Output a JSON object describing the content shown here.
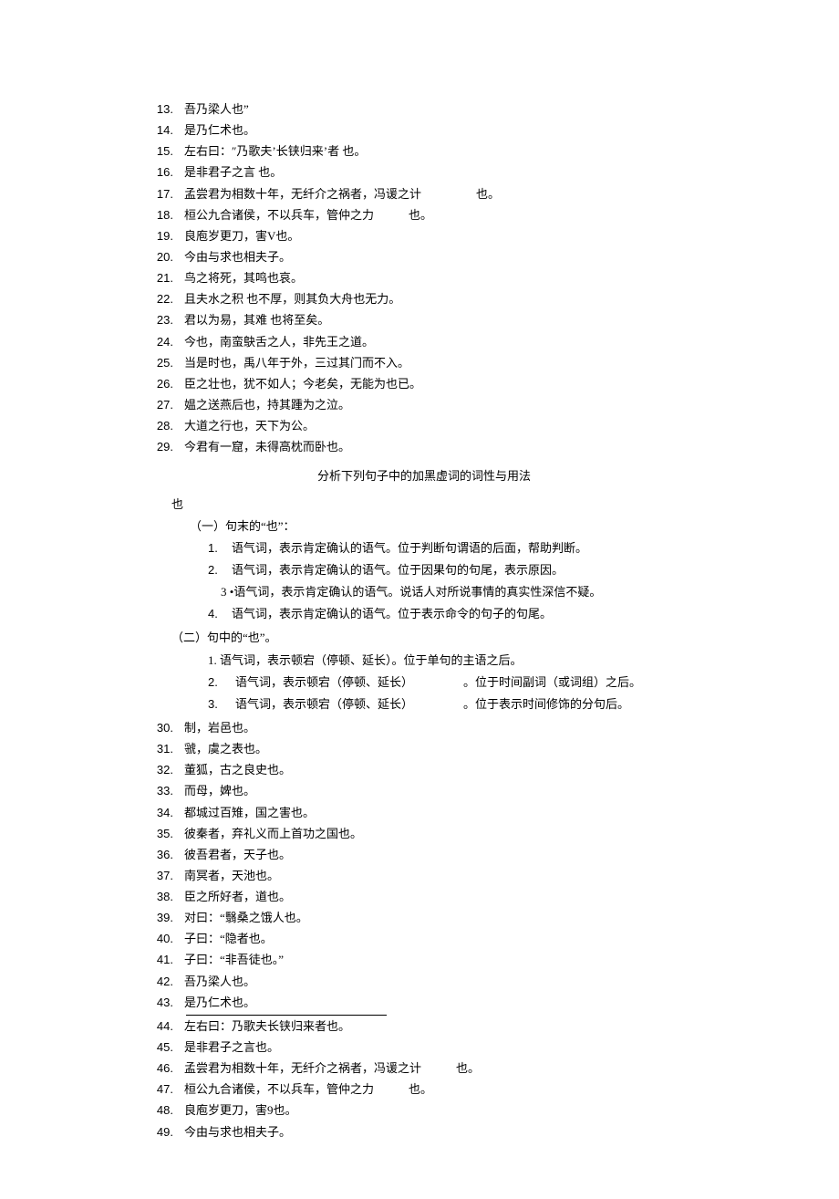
{
  "list1": [
    {
      "n": "13.",
      "t": "吾乃梁人也”"
    },
    {
      "n": "14.",
      "t": "是乃仁术也。"
    },
    {
      "n": "15.",
      "t": "左右曰：″乃歌夫’长铗归来’者  也。"
    },
    {
      "n": "16.",
      "t": "是非君子之言  也。"
    },
    {
      "n": "17.",
      "t": "孟尝君为相数十年，无纤介之祸者，冯谖之计",
      "after": "也。"
    },
    {
      "n": "18.",
      "t": "桓公九合诸侯，不以兵车，管仲之力",
      "after": "也。",
      "gapSmall": true
    },
    {
      "n": "19.",
      "t": "良庖岁更刀，害V也。"
    },
    {
      "n": "20.",
      "t": "今由与求也相夫子。"
    },
    {
      "n": "21.",
      "t": "鸟之将死，其鸣也哀。"
    },
    {
      "n": "22.",
      "t": "且夫水之积  也不厚，则其负大舟也无力。"
    },
    {
      "n": "23.",
      "t": "君以为易，其难  也将至矣。"
    },
    {
      "n": "24.",
      "t": "今也，南蛮鴃舌之人，非先王之道。"
    },
    {
      "n": "25.",
      "t": "当是时也，禹八年于外，三过其门而不入。"
    },
    {
      "n": "26.",
      "t": "臣之壮也，犹不如人；今老矣，无能为也已。"
    },
    {
      "n": "27.",
      "t": "媪之送燕后也，持其踵为之泣。"
    },
    {
      "n": "28.",
      "t": "大道之行也，天下为公。"
    },
    {
      "n": "29.",
      "t": "今君有一窟，未得高枕而卧也。"
    }
  ],
  "sectionTitle": "分析下列句子中的加黑虚词的词性与用法",
  "ye": "也",
  "subA": "（一）句末的“也”：",
  "subAItems": [
    {
      "n": "1.",
      "t": "语气词，表示肯定确认的语气。位于判断句谓语的后面，帮助判断。"
    },
    {
      "n": "2.",
      "t": "语气词，表示肯定确认的语气。位于因果句的句尾，表示原因。"
    },
    {
      "n": "3 •",
      "t": "语气词，表示肯定确认的语气。说话人对所说事情的真实性深信不疑。"
    },
    {
      "n": "4.",
      "t": "语气词，表示肯定确认的语气。位于表示命令的句子的句尾。"
    }
  ],
  "subB": "（二）句中的“也”。",
  "subBItem1": "1. 语气词，表示顿宕（停顿、延长）。位于单句的主语之后。",
  "subB2": {
    "n": "2.",
    "l": "语气词，表示顿宕（停顿、延长）",
    "r": "。位于时间副词（或词组）之后。"
  },
  "subB3": {
    "n": "3.",
    "l": "语气词，表示顿宕（停顿、延长）",
    "r": "。位于表示时间修饰的分句后。"
  },
  "list2": [
    {
      "n": "30.",
      "t": "制，岩邑也。"
    },
    {
      "n": "31.",
      "t": "虢，虞之表也。"
    },
    {
      "n": "32.",
      "t": "董狐，古之良史也。"
    },
    {
      "n": "33.",
      "t": "而母，婢也。"
    },
    {
      "n": "34.",
      "t": "都城过百雉，国之害也。"
    },
    {
      "n": "35.",
      "t": "彼秦者，弃礼义而上首功之国也。"
    },
    {
      "n": "36.",
      "t": "彼吾君者，天子也。"
    },
    {
      "n": "37.",
      "t": "南冥者，天池也。"
    },
    {
      "n": "38.",
      "t": "臣之所好者，道也。"
    },
    {
      "n": "39.",
      "t": "对曰：“翳桑之饿人也。"
    },
    {
      "n": "40.",
      "t": "子曰：“隐者也。"
    },
    {
      "n": "41.",
      "t": "子曰：“非吾徒也。”"
    },
    {
      "n": "42.",
      "t": "吾乃梁人也。"
    },
    {
      "n": "43.",
      "t": "是乃仁术也。"
    }
  ],
  "list3": [
    {
      "n": "44.",
      "t": "左右曰：乃歌夫长铗归来者也。"
    },
    {
      "n": "45.",
      "t": "是非君子之言也。"
    },
    {
      "n": "46.",
      "t": "孟尝君为相数十年，无纤介之祸者，冯谖之计",
      "after": "也。",
      "gapSmall": true
    },
    {
      "n": "47.",
      "t": "桓公九合诸侯，不以兵车，管仲之力",
      "after": "也。",
      "gapSmall": true
    },
    {
      "n": "48.",
      "t": "良庖岁更刀，害9也。"
    },
    {
      "n": "49.",
      "t": "今由与求也相夫子。"
    }
  ]
}
